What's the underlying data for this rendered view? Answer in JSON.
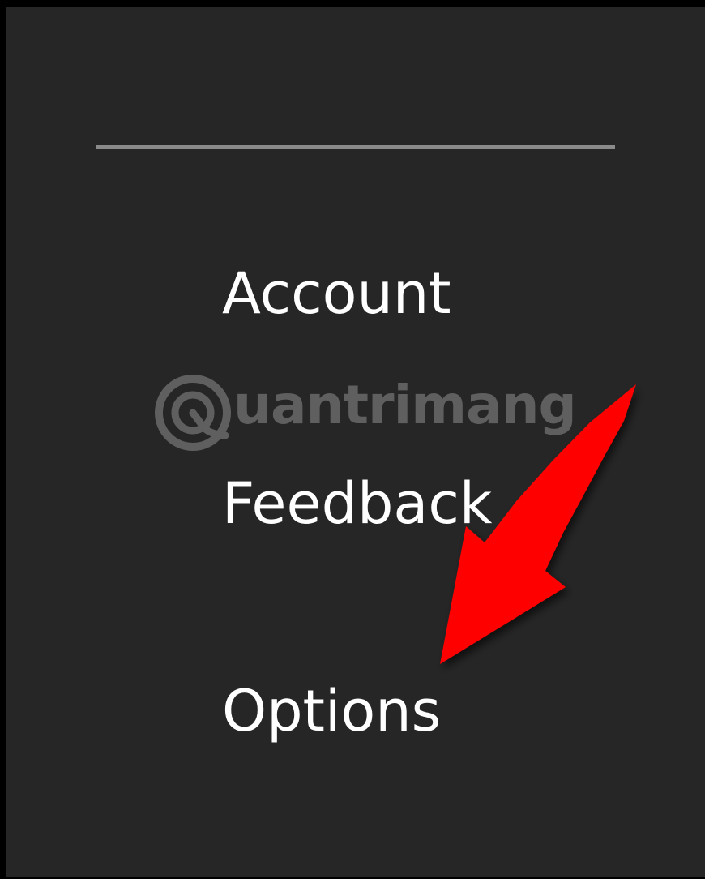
{
  "menu": {
    "items": [
      {
        "label": "Account"
      },
      {
        "label": "Feedback"
      },
      {
        "label": "Options"
      }
    ]
  },
  "watermark": {
    "text": "uantrimang",
    "brand": "Quantrimang"
  },
  "annotation": {
    "icon": "red-arrow-pointer",
    "color": "#ff0000",
    "target": "Options"
  },
  "colors": {
    "background": "#262626",
    "divider": "#8a8a8a",
    "text": "#ffffff"
  }
}
